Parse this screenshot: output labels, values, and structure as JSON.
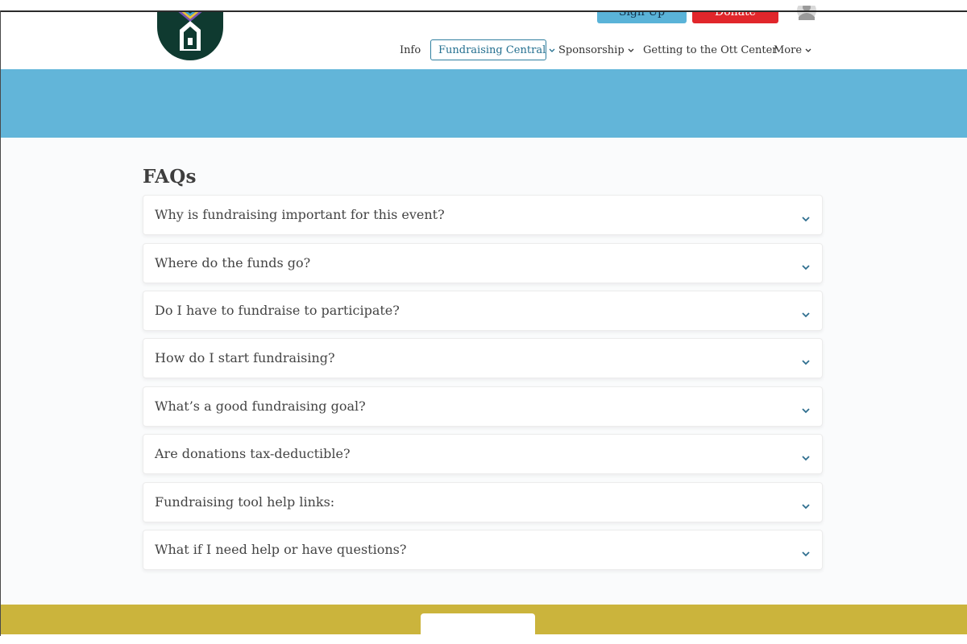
{
  "header": {
    "logo_icon": "house-logo-icon",
    "signup_label": "Sign Up",
    "donate_label": "Donate",
    "avatar_icon": "user-avatar-icon",
    "colors": {
      "signup": "#5ab3d8",
      "donate": "#e1262b",
      "band": "#62b5d9",
      "footer": "#cbb43c"
    }
  },
  "nav": {
    "items": [
      {
        "label": "Info",
        "has_dropdown": false
      },
      {
        "label": "Fundraising Central",
        "has_dropdown": true,
        "active": true
      },
      {
        "label": "Sponsorship",
        "has_dropdown": true
      },
      {
        "label": "Getting to the Ott Center",
        "has_dropdown": false
      },
      {
        "label": "More",
        "has_dropdown": true
      }
    ]
  },
  "faq": {
    "title": "FAQs",
    "items": [
      {
        "question": "Why is fundraising important for this event?"
      },
      {
        "question": "Where do the funds go?"
      },
      {
        "question": "Do I have to fundraise to participate?"
      },
      {
        "question": "How do I start fundraising?"
      },
      {
        "question": "What’s a good fundraising goal?"
      },
      {
        "question": "Are donations tax-deductible?"
      },
      {
        "question": "Fundraising tool help links:"
      },
      {
        "question": "What if I need help or have questions?"
      }
    ],
    "chevron_icon": "chevron-down-icon"
  }
}
